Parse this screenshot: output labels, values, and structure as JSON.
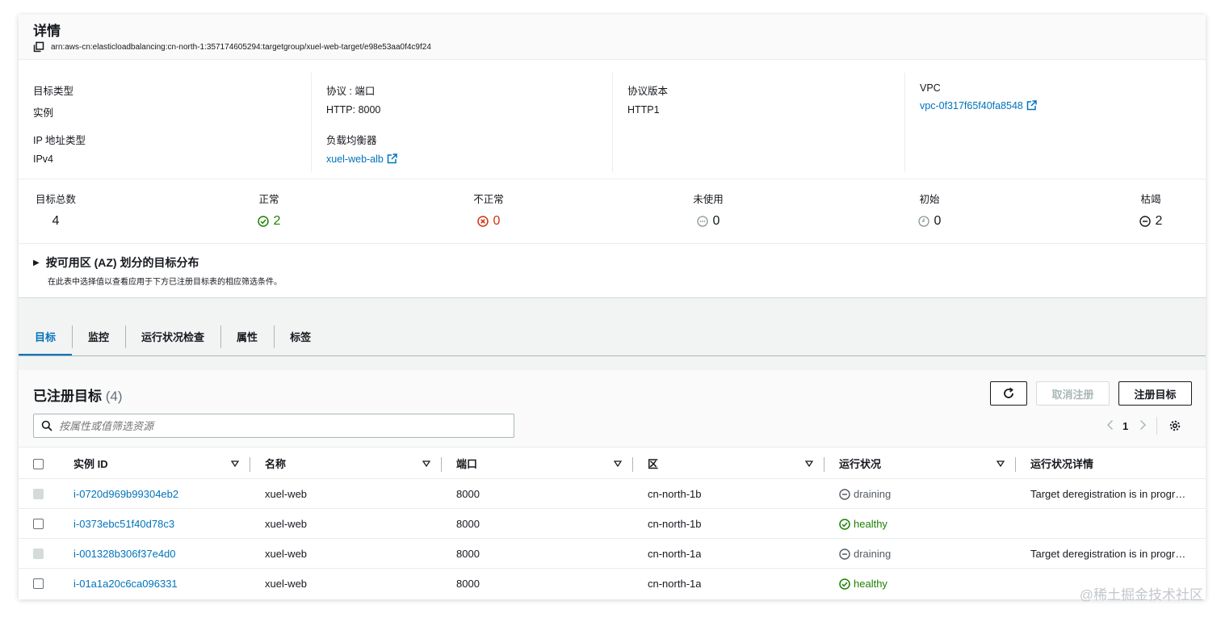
{
  "details": {
    "title": "详情",
    "arn": "arn:aws-cn:elasticloadbalancing:cn-north-1:357174605294:targetgroup/xuel-web-target/e98e53aa0f4c9f24",
    "target_type_label": "目标类型",
    "target_type_value": "实例",
    "ip_type_label": "IP 地址类型",
    "ip_type_value": "IPv4",
    "protocol_port_label": "协议 : 端口",
    "protocol_port_value": "HTTP: 8000",
    "load_balancer_label": "负载均衡器",
    "load_balancer_value": "xuel-web-alb",
    "protocol_version_label": "协议版本",
    "protocol_version_value": "HTTP1",
    "vpc_label": "VPC",
    "vpc_value": "vpc-0f317f65f40fa8548"
  },
  "counts": {
    "total_label": "目标总数",
    "total_value": "4",
    "healthy_label": "正常",
    "healthy_value": "2",
    "unhealthy_label": "不正常",
    "unhealthy_value": "0",
    "unused_label": "未使用",
    "unused_value": "0",
    "initial_label": "初始",
    "initial_value": "0",
    "draining_label": "枯竭",
    "draining_value": "2"
  },
  "az": {
    "title": "按可用区 (AZ) 划分的目标分布",
    "subtitle": "在此表中选择值以查看应用于下方已注册目标表的相应筛选条件。"
  },
  "tabs": [
    "目标",
    "监控",
    "运行状况检查",
    "属性",
    "标签"
  ],
  "panel": {
    "title": "已注册目标",
    "count": "(4)",
    "deregister_label": "取消注册",
    "register_label": "注册目标",
    "search_placeholder": "按属性或值筛选资源",
    "page": "1"
  },
  "table": {
    "headers": [
      "实例 ID",
      "名称",
      "端口",
      "区",
      "运行状况",
      "运行状况详情"
    ],
    "rows": [
      {
        "id": "i-0720d969b99304eb2",
        "name": "xuel-web",
        "port": "8000",
        "zone": "cn-north-1b",
        "status": "draining",
        "detail": "Target deregistration is in progr…"
      },
      {
        "id": "i-0373ebc51f40d78c3",
        "name": "xuel-web",
        "port": "8000",
        "zone": "cn-north-1b",
        "status": "healthy",
        "detail": ""
      },
      {
        "id": "i-001328b306f37e4d0",
        "name": "xuel-web",
        "port": "8000",
        "zone": "cn-north-1a",
        "status": "draining",
        "detail": "Target deregistration is in progr…"
      },
      {
        "id": "i-01a1a20c6ca096331",
        "name": "xuel-web",
        "port": "8000",
        "zone": "cn-north-1a",
        "status": "healthy",
        "detail": ""
      }
    ]
  },
  "watermark": "@稀土掘金技术社区",
  "colors": {
    "link": "#0073bb",
    "healthy": "#1d8102",
    "unhealthy": "#d13212",
    "muted": "#687078"
  }
}
